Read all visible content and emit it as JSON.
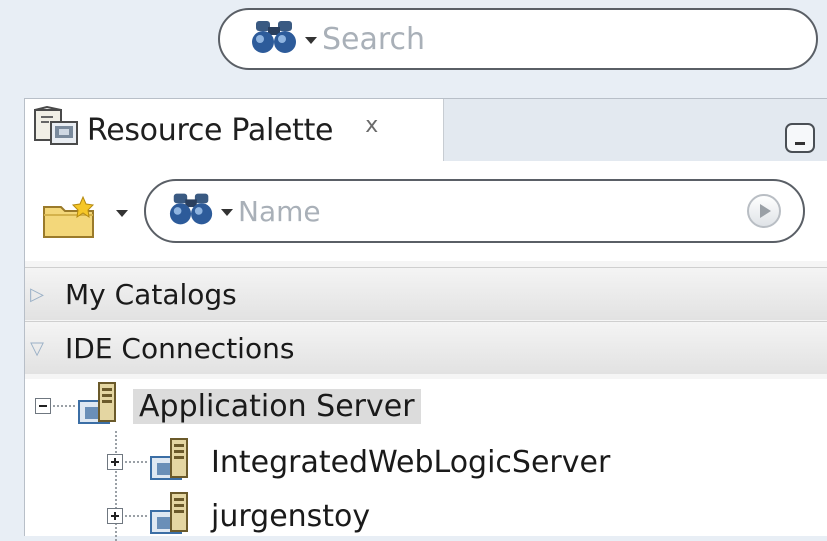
{
  "top_search": {
    "placeholder": "Search"
  },
  "panel": {
    "tab_label": "Resource Palette",
    "close_glyph": "x",
    "name_search": {
      "placeholder": "Name"
    }
  },
  "sections": [
    {
      "label": "My Catalogs",
      "state": "collapsed"
    },
    {
      "label": "IDE Connections",
      "state": "expanded"
    }
  ],
  "tree": {
    "root": {
      "label": "Application Server",
      "expanded": true,
      "selected": true
    },
    "children": [
      {
        "label": "IntegratedWebLogicServer",
        "expanded": false
      },
      {
        "label": "jurgenstoy",
        "expanded": false
      }
    ]
  },
  "icons": {
    "binoculars": "binoculars-icon",
    "server": "server-icon",
    "folder_new": "new-folder-icon",
    "palette": "resource-palette-icon"
  }
}
